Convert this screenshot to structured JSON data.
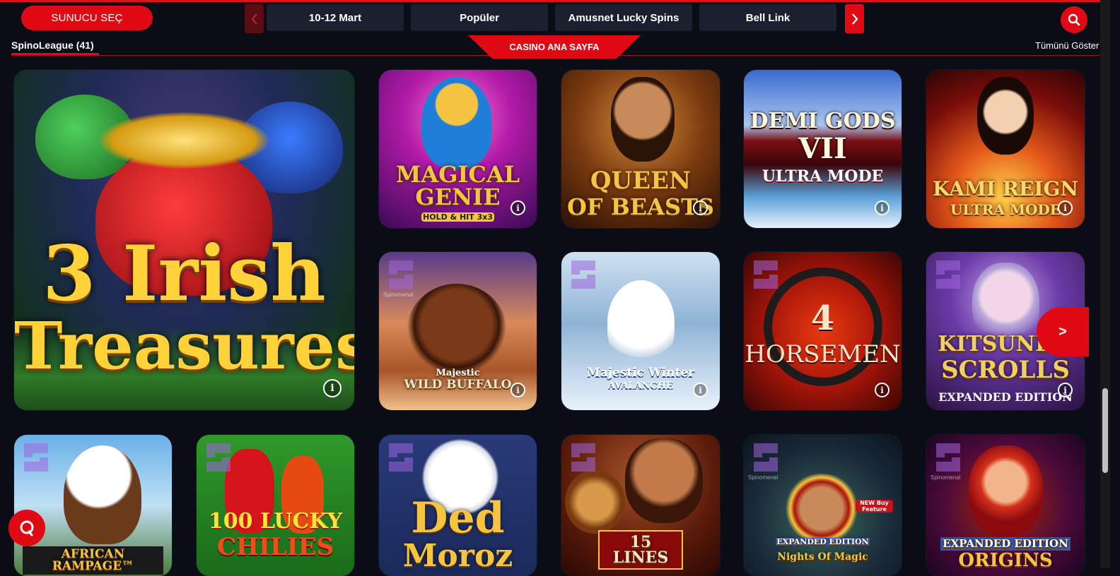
{
  "header": {
    "provider_button": "SUNUCU SEÇ",
    "tabs": [
      "10-12 Mart",
      "Popüler",
      "Amusnet Lucky Spins",
      "Bell Link"
    ],
    "prev_icon": "chevron-left-icon",
    "next_icon": "chevron-right-icon",
    "search_icon": "search-icon"
  },
  "section": {
    "title": "SpinoLeague (41)",
    "casino_home": "CASINO ANA SAYFA",
    "show_all": "Tümünü Göster",
    "next_label": ">"
  },
  "games": [
    {
      "title_line1": "3 Irish",
      "title_line2": "Treasures"
    },
    {
      "title_line1": "MAGICAL",
      "title_line2": "GENIE",
      "subtitle": "HOLD & HIT 3x3"
    },
    {
      "title_line1": "QUEEN",
      "title_line2": "OF BEASTS"
    },
    {
      "title_line1": "DEMI GODS",
      "title_line2": "VII",
      "subtitle": "ULTRA MODE"
    },
    {
      "title_line1": "KAMI REIGN",
      "subtitle": "ULTRA MODE"
    },
    {
      "title_line1": "Majestic",
      "title_line2": "WILD BUFFALO"
    },
    {
      "title_line1": "Majestic Winter",
      "title_line2": "AVALANCHE"
    },
    {
      "title_line1": "4",
      "title_line2": "HORSEMEN"
    },
    {
      "title_line1": "KITSUNE'S",
      "title_line2": "SCROLLS",
      "subtitle": "EXPANDED EDITION"
    },
    {
      "title_line1": "AFRICAN RAMPAGE™"
    },
    {
      "title_line1": "100 LUCKY",
      "title_line2": "CHILIES"
    },
    {
      "title_line1": "Ded",
      "title_line2": "Moroz"
    },
    {
      "title_line1": "15 LINES"
    },
    {
      "title_line1": "EXPANDED EDITION",
      "title_line2": "Nights Of Magic",
      "subtitle": "NEW Buy Feature"
    },
    {
      "title_line1": "EXPANDED EDITION",
      "title_line2": "ORIGINS"
    }
  ],
  "provider_badge": "Spinomenal",
  "info_icon": "info-icon",
  "chat_icon": "chat-icon"
}
